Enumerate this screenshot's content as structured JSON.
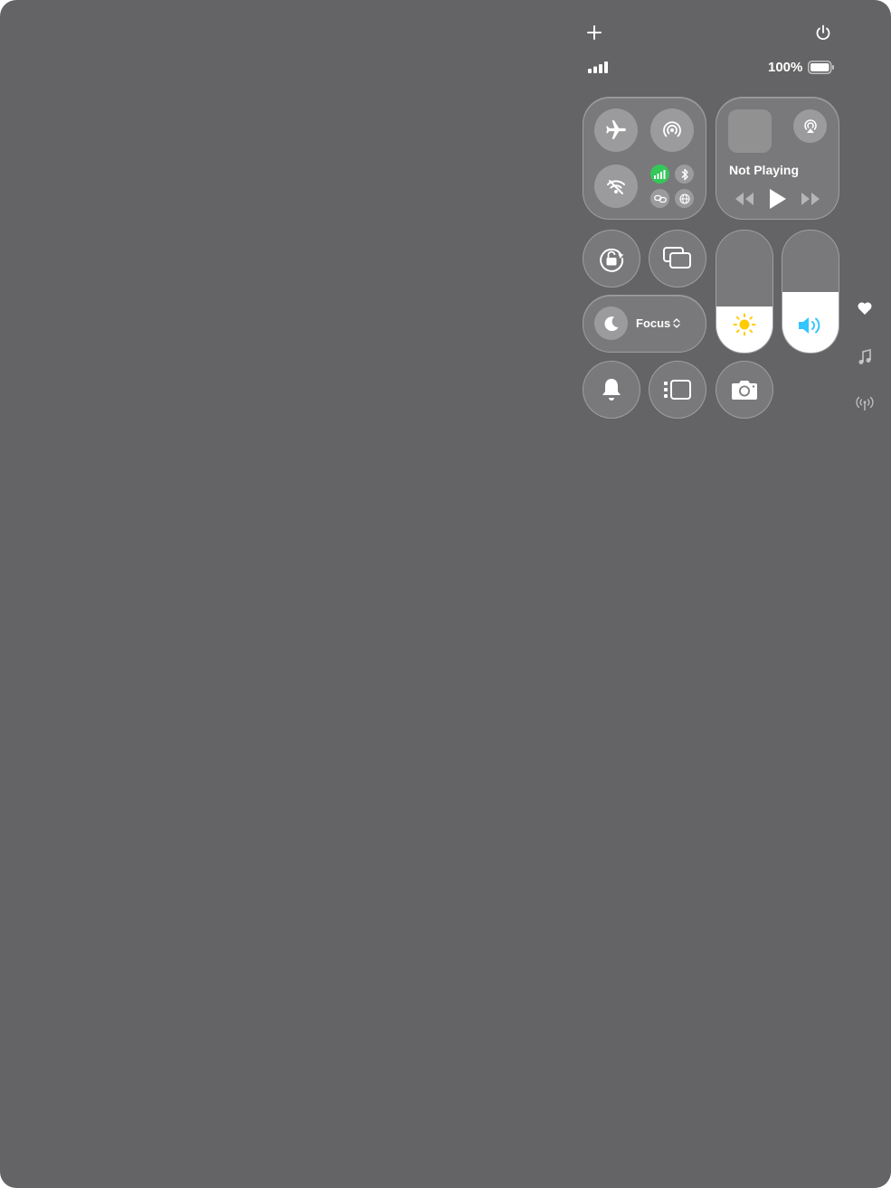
{
  "status_bar": {
    "battery_percent": "100%"
  },
  "media": {
    "now_playing": "Not Playing"
  },
  "focus": {
    "label": "Focus"
  },
  "sliders": {
    "brightness_level": 0.38,
    "volume_level": 0.5
  },
  "colors": {
    "background": "#646466",
    "cellular_active": "#34c759",
    "brightness_icon": "#ffcc00",
    "volume_icon": "#32c5ff"
  },
  "side_rail": {
    "icons": [
      "heart-icon",
      "music-note-icon",
      "antenna-icon"
    ]
  }
}
